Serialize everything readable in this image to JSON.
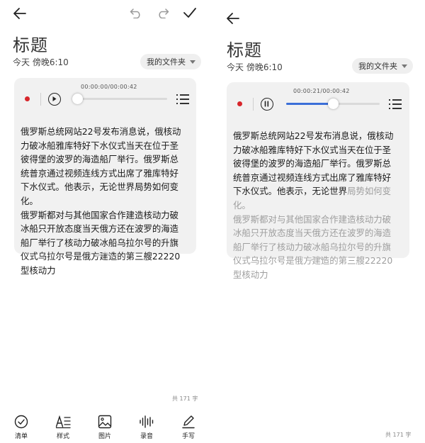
{
  "left": {
    "title": "标题",
    "meta": "今天 傍晚6:10",
    "folder_label": "我的文件夹",
    "audio": {
      "time": "00:00:00/00:00:42",
      "state": "paused",
      "progress": 0.0
    },
    "body_lines": [
      "俄罗斯总统网站22号发布消息说，俄核动",
      "力破冰船雅库特好下水仪式当天在位于圣",
      "彼得堡的波罗的海造船厂举行。俄罗斯总",
      "统普京通过视频连线方式出席了雅库特好",
      "下水仪式。他表示，无论世界局势如何变化。",
      "俄罗斯都对与其他国家合作建造核动力破",
      "冰船只开放态度当天俄方还在波罗的海造",
      "船厂举行了核动力破冰船乌拉尔号的升旗",
      "仪式乌拉尔号是俄方建造的第三艘22220",
      "型核动力"
    ],
    "word_count": "共 171 字",
    "toolbar": [
      {
        "label": "清单",
        "icon": "checklist-icon"
      },
      {
        "label": "样式",
        "icon": "text-style-icon"
      },
      {
        "label": "图片",
        "icon": "image-icon"
      },
      {
        "label": "录音",
        "icon": "voice-record-icon"
      },
      {
        "label": "手写",
        "icon": "handwriting-icon"
      }
    ]
  },
  "right": {
    "title": "标题",
    "meta": "今天 傍晚6:10",
    "folder_label": "我的文件夹",
    "audio": {
      "time": "00:00:21/00:00:42",
      "state": "playing",
      "progress": 0.5
    },
    "body_lines_dark": [
      "俄罗斯总统网站22号发布消息说，俄核动",
      "力破冰船雅库特好下水仪式当天在位于圣",
      "彼得堡的波罗的海造船厂举行。俄罗斯总",
      "统普京通过视频连线方式出席了雅库特好",
      "下水仪式。他表示，无论世界"
    ],
    "line5_faded": "局势如何变化。",
    "body_lines_faded": [
      "俄罗斯都对与其他国家合作建造核动力破",
      "冰船只开放态度当天俄方还在波罗的海造",
      "船厂举行了核动力破冰船乌拉尔号的升旗",
      "仪式乌拉尔号是俄方建造的第三艘22220",
      "型核动力"
    ],
    "word_count": "共 171 字"
  },
  "colors": {
    "accent": "#3b6fd8",
    "record": "#d7262b",
    "card": "#f1f1f1"
  }
}
